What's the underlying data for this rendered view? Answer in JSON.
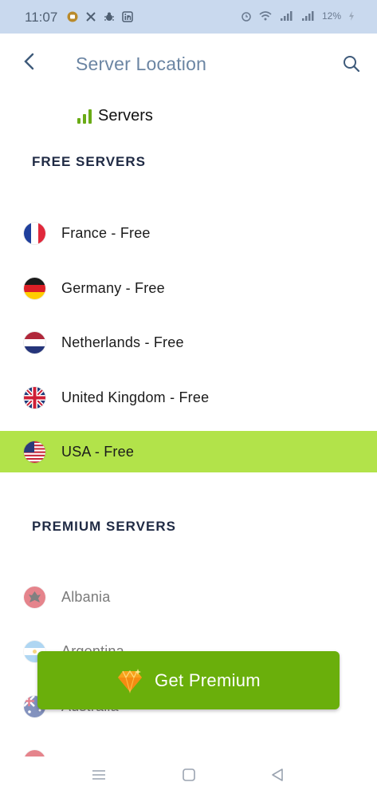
{
  "statusbar": {
    "time": "11:07",
    "battery": "12%"
  },
  "header": {
    "title": "Server Location"
  },
  "servers_label": "Servers",
  "free_section": {
    "title": "FREE SERVERS",
    "items": [
      {
        "label": "France - Free",
        "flag": "france-flag-icon"
      },
      {
        "label": "Germany - Free",
        "flag": "germany-flag-icon"
      },
      {
        "label": "Netherlands - Free",
        "flag": "netherlands-flag-icon"
      },
      {
        "label": "United Kingdom - Free",
        "flag": "uk-flag-icon"
      },
      {
        "label": "USA - Free",
        "flag": "usa-flag-icon",
        "selected": true
      }
    ]
  },
  "premium_section": {
    "title": "PREMIUM SERVERS",
    "items": [
      {
        "label": "Albania",
        "flag": "albania-flag-icon"
      },
      {
        "label": "Argentina",
        "flag": "argentina-flag-icon"
      },
      {
        "label": "Australia",
        "flag": "australia-flag-icon"
      }
    ]
  },
  "premium_button": {
    "label": "Get Premium"
  },
  "colors": {
    "accent_green": "#6aaf0b",
    "selected_row": "#b2e34a",
    "title_blue": "#6b85a3"
  }
}
